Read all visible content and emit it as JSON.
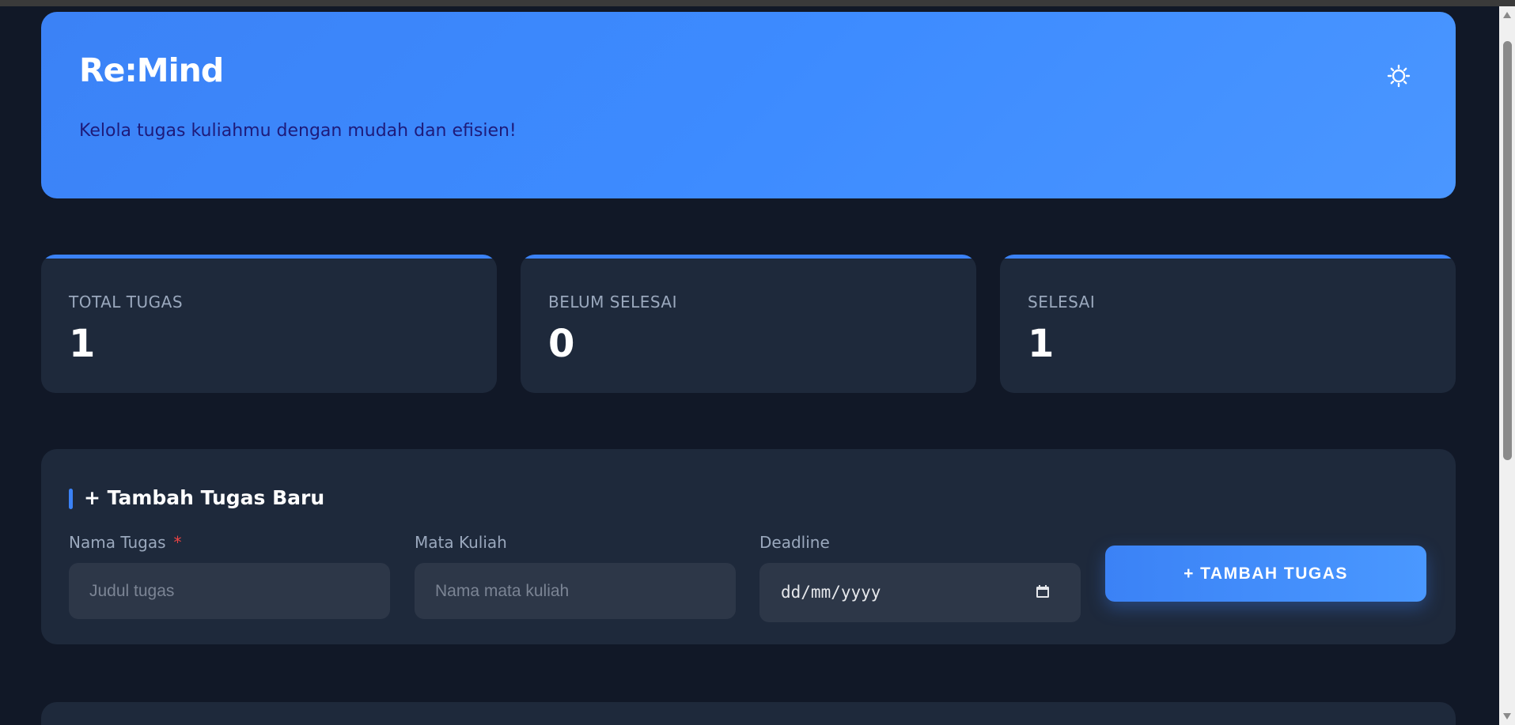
{
  "header": {
    "title": "Re:Mind",
    "subtitle": "Kelola tugas kuliahmu dengan mudah dan efisien!",
    "theme_icon": "sun-icon"
  },
  "stats": [
    {
      "label": "TOTAL TUGAS",
      "value": "1"
    },
    {
      "label": "BELUM SELESAI",
      "value": "0"
    },
    {
      "label": "SELESAI",
      "value": "1"
    }
  ],
  "form": {
    "title": "+ Tambah Tugas Baru",
    "fields": {
      "name": {
        "label": "Nama Tugas",
        "required_mark": "*",
        "placeholder": "Judul tugas",
        "value": ""
      },
      "course": {
        "label": "Mata Kuliah",
        "placeholder": "Nama mata kuliah",
        "value": ""
      },
      "deadline": {
        "label": "Deadline",
        "value": "dd/mm/yyyy",
        "icon": "calendar-icon"
      }
    },
    "submit_label": "+ TAMBAH TUGAS"
  },
  "colors": {
    "accent": "#3b82f6",
    "background": "#111827",
    "card": "#1e293b",
    "input": "#2d3748",
    "required": "#ef4444"
  }
}
